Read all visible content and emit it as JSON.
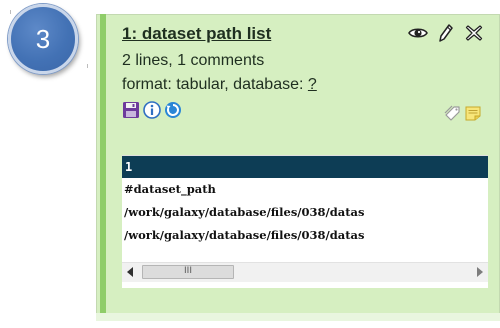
{
  "step": {
    "number": "3"
  },
  "dataset": {
    "title": "1: dataset path list",
    "summary": "2 lines, 1 comments",
    "format_prefix": "format: tabular, database: ",
    "database_value": "?"
  },
  "icons": {
    "view": "eye-icon",
    "edit": "pencil-icon",
    "delete": "x-icon",
    "save": "floppy-disk-icon",
    "info": "info-icon",
    "rerun": "rerun-icon",
    "tags": "tag-icon",
    "annotation": "note-icon"
  },
  "peek": {
    "header": "1",
    "rows": [
      "#dataset_path",
      "/work/galaxy/database/files/038/datas",
      "/work/galaxy/database/files/038/datas"
    ],
    "scroll_thumb_label": "III"
  },
  "colors": {
    "panel_bg": "#d6efc1",
    "panel_accent": "#8fcd69",
    "peek_header": "#0d3d55",
    "badge": "#4372b5"
  }
}
